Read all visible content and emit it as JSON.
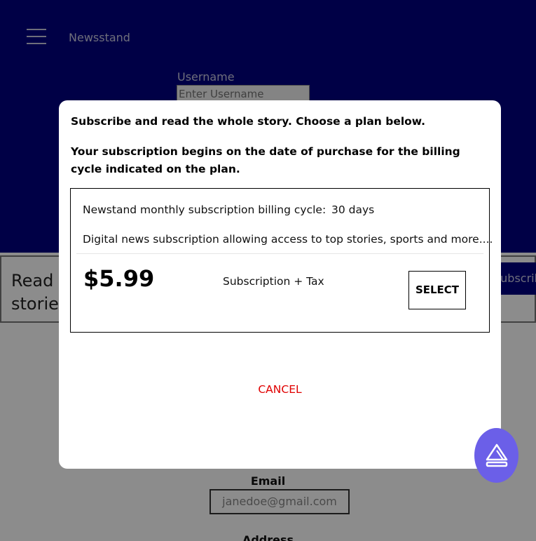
{
  "header": {
    "menu_icon": "hamburger-menu-icon",
    "brand": "Newsstand",
    "username_label": "Username",
    "username_placeholder": "Enter Username"
  },
  "teaser": {
    "text": "Read the top stories",
    "subscribe_label": "Subscribe"
  },
  "form": {
    "email_label": "Email",
    "email_value": "janedoe@gmail.com",
    "address_label": "Address"
  },
  "modal": {
    "title": "Subscribe and read the whole story. Choose a plan below.",
    "note": "Your subscription begins on the date of purchase for the billing cycle indicated on the plan.",
    "plan": {
      "cycle_label": "Newstand monthly subscription billing cycle:",
      "cycle_value": "30 days",
      "description": "Digital news subscription allowing access to top stories, sports and more....",
      "price": "$5.99",
      "price_note": "Subscription + Tax",
      "select_label": "SELECT"
    },
    "cancel_label": "CANCEL"
  },
  "fab": {
    "icon": "eject-icon",
    "color": "#6b5fe8"
  },
  "colors": {
    "header_bg": "#000080",
    "cancel": "#e00000"
  }
}
